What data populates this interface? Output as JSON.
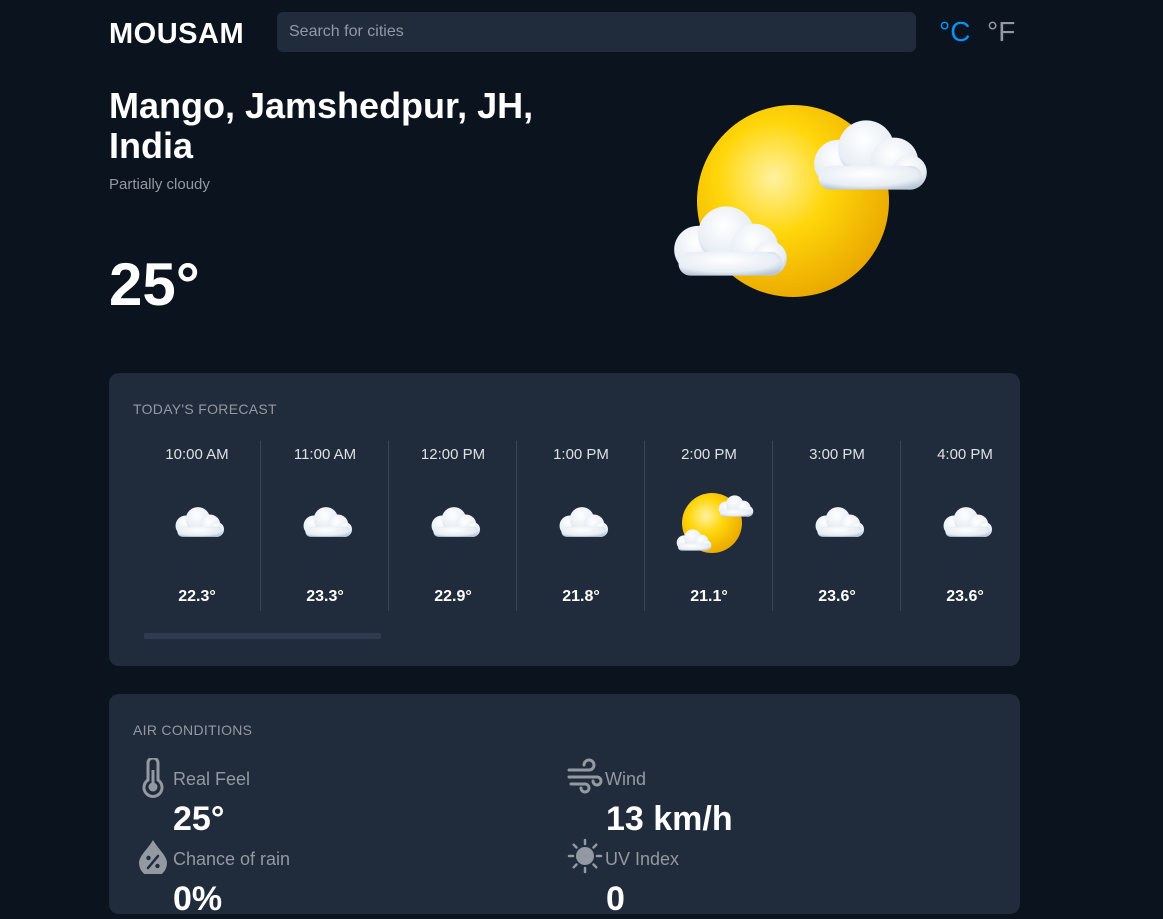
{
  "header": {
    "logo": "MOUSAM",
    "search_placeholder": "Search for cities",
    "unit_celsius": "°C",
    "unit_fahrenheit": "°F"
  },
  "current": {
    "location": "Mango, Jamshedpur, JH, India",
    "condition": "Partially cloudy",
    "temperature": "25°",
    "icon": "partly-cloudy-icon"
  },
  "forecast": {
    "title": "TODAY'S FORECAST",
    "hours": [
      {
        "time": "10:00 AM",
        "temp": "22.3°",
        "icon": "cloudy-icon"
      },
      {
        "time": "11:00 AM",
        "temp": "23.3°",
        "icon": "cloudy-icon"
      },
      {
        "time": "12:00 PM",
        "temp": "22.9°",
        "icon": "cloudy-icon"
      },
      {
        "time": "1:00 PM",
        "temp": "21.8°",
        "icon": "cloudy-icon"
      },
      {
        "time": "2:00 PM",
        "temp": "21.1°",
        "icon": "partly-cloudy-icon"
      },
      {
        "time": "3:00 PM",
        "temp": "23.6°",
        "icon": "cloudy-icon"
      },
      {
        "time": "4:00 PM",
        "temp": "23.6°",
        "icon": "cloudy-icon"
      }
    ]
  },
  "air": {
    "title": "AIR CONDITIONS",
    "real_feel_label": "Real Feel",
    "real_feel_value": "25°",
    "wind_label": "Wind",
    "wind_value": "13 km/h",
    "rain_label": "Chance of rain",
    "rain_value": "0%",
    "uv_label": "UV Index",
    "uv_value": "0"
  },
  "colors": {
    "background": "#0b131e",
    "card": "#202b3b",
    "accent": "#0095ff",
    "muted": "#9399a2"
  }
}
